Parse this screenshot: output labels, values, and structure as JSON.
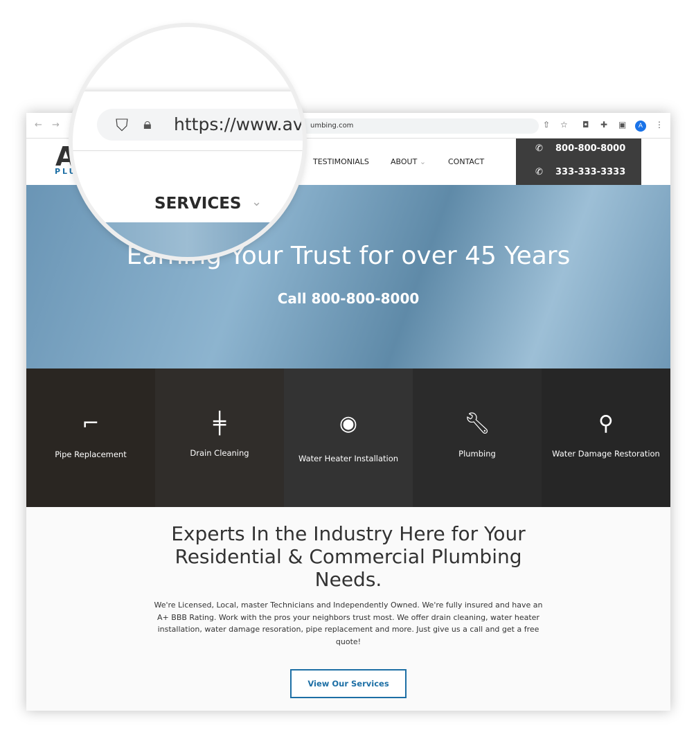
{
  "browser": {
    "url_visible": "https://www.av",
    "url_tail": "umbing.com",
    "back": "←",
    "forward": "→",
    "avatar_letter": "A"
  },
  "logo": {
    "letter": "A",
    "sub": "PLU"
  },
  "nav": {
    "services": "SERVICES",
    "testimonials": "TESTIMONIALS",
    "about": "ABOUT",
    "contact": "CONTACT",
    "chevron": "⌄"
  },
  "phones": [
    "800-800-8000",
    "333-333-3333"
  ],
  "hero": {
    "title": "Earning Your Trust for over 45 Years",
    "subtitle": "Call 800-800-8000",
    "color": "#6f98b6"
  },
  "services": [
    {
      "label": "Pipe Replacement",
      "icon": "pipe-elbow-icon"
    },
    {
      "label": "Drain Cleaning",
      "icon": "valve-pipe-icon"
    },
    {
      "label": "Water Heater Installation",
      "icon": "gauge-icon"
    },
    {
      "label": "Plumbing",
      "icon": "wrench-icon"
    },
    {
      "label": "Water Damage Restoration",
      "icon": "pipe-leak-icon"
    }
  ],
  "content": {
    "heading": "Experts In the Industry Here for Your Residential & Commercial Plumbing Needs.",
    "body": "We're Licensed, Local, master Technicians and Independently Owned. We're fully insured and have an A+ BBB Rating. Work with the pros your neighbors trust most. We offer drain cleaning, water heater installation, water damage resoration, pipe replacement and more. Just give us a call and get a free quote!",
    "button": "View Our Services"
  },
  "colors": {
    "accent": "#1d6fa5",
    "phone_box": "#3d3d3d"
  }
}
